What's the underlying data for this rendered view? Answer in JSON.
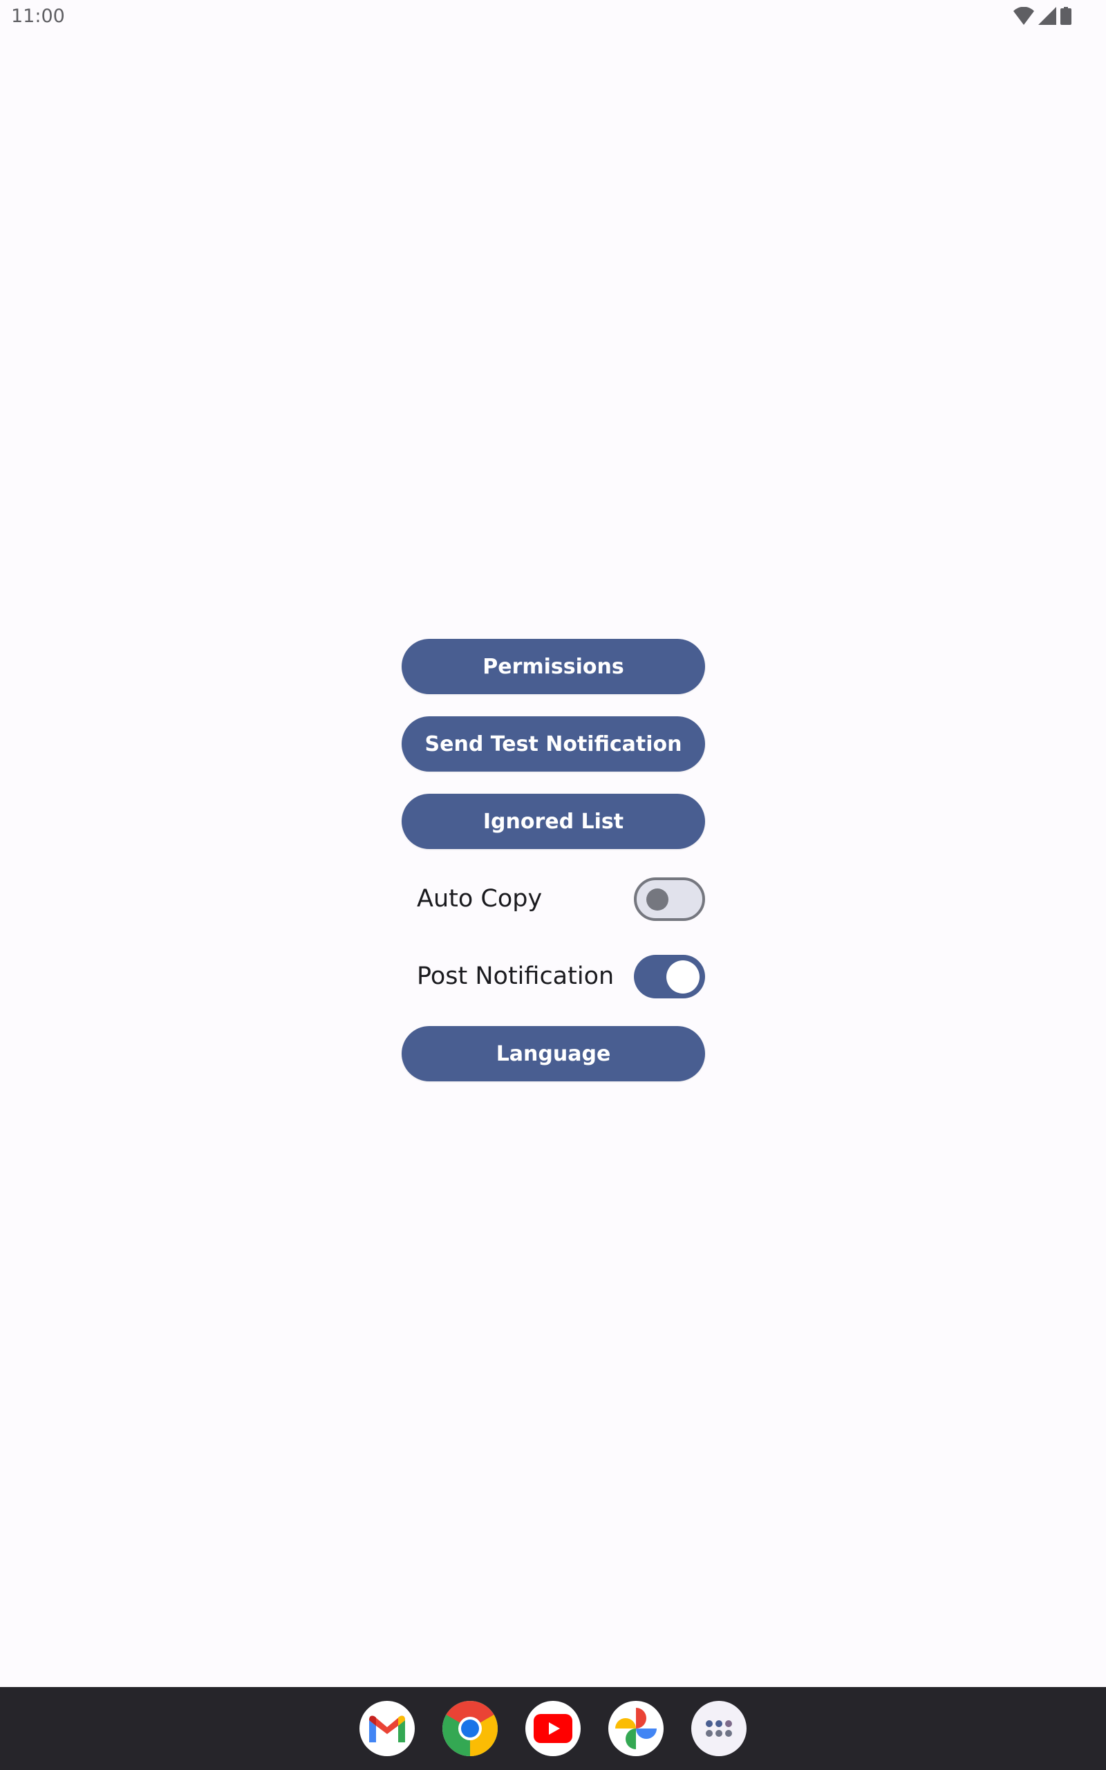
{
  "status_bar": {
    "time": "11:00",
    "icons": [
      "wifi-icon",
      "cellular-signal-icon",
      "battery-icon"
    ]
  },
  "main": {
    "buttons": [
      {
        "label": "Permissions"
      },
      {
        "label": "Send Test Notification"
      },
      {
        "label": "Ignored List"
      },
      {
        "label": "Language"
      }
    ],
    "toggles": [
      {
        "label": "Auto Copy",
        "state": "off"
      },
      {
        "label": "Post Notification",
        "state": "on"
      }
    ]
  },
  "dock": {
    "apps": [
      {
        "name": "Gmail",
        "icon": "gmail-icon"
      },
      {
        "name": "Chrome",
        "icon": "chrome-icon"
      },
      {
        "name": "YouTube",
        "icon": "youtube-icon"
      },
      {
        "name": "Photos",
        "icon": "photos-icon"
      },
      {
        "name": "All apps",
        "icon": "app-drawer-icon"
      }
    ]
  },
  "colors": {
    "primary": "#495e91",
    "background": "#fdfbfe",
    "dock": "#26252a",
    "switch_off_track": "#e1e2ec",
    "switch_off_outline": "#75777f"
  }
}
